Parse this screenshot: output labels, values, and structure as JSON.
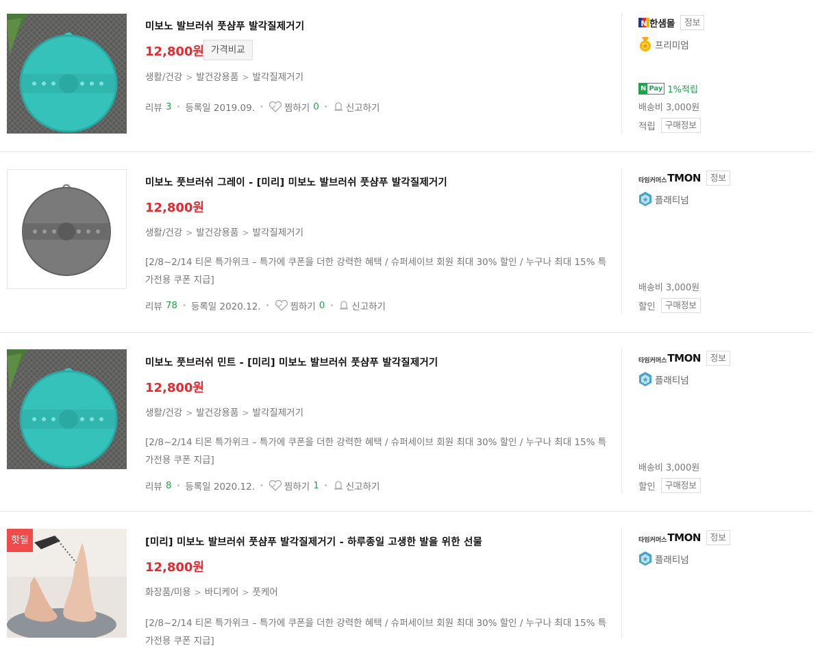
{
  "items": [
    {
      "title": "미보노 발브러쉬 풋샴푸 발각질제거기",
      "price": "12,800원",
      "compare_label": "가격비교",
      "category": [
        "생활/건강",
        "발건강용품",
        "발각질제거기"
      ],
      "description": "",
      "review_label": "리뷰",
      "review_count": "3",
      "reg_date": "등록일 2019.09.",
      "zzim_label": "찜하기",
      "zzim_count": "0",
      "report_label": "신고하기",
      "mall_name": "한샘몰",
      "mall_info_label": "정보",
      "grade": "프리미엄",
      "npay_label": "1%적립",
      "shipping": "배송비 3,000원",
      "benefit_label": "적립",
      "buy_info_label": "구매정보",
      "hot_badge": ""
    },
    {
      "title": "미보노 풋브러쉬 그레이 - [미리] 미보노 발브러쉬 풋샴푸 발각질제거기",
      "price": "12,800원",
      "compare_label": "",
      "category": [
        "생활/건강",
        "발건강용품",
        "발각질제거기"
      ],
      "description": "[2/8~2/14 티몬 특가위크 – 특가에 쿠폰을 더한 강력한 혜택 / 슈퍼세이브 회원 최대 30% 할인 / 누구나 최대 15% 특가전용 쿠폰 지급]",
      "review_label": "리뷰",
      "review_count": "78",
      "reg_date": "등록일 2020.12.",
      "zzim_label": "찜하기",
      "zzim_count": "0",
      "report_label": "신고하기",
      "mall_small": "타임커머스",
      "mall_name": "TMON",
      "mall_info_label": "정보",
      "grade": "플래티넘",
      "npay_label": "",
      "shipping": "배송비 3,000원",
      "benefit_label": "할인",
      "buy_info_label": "구매정보",
      "hot_badge": ""
    },
    {
      "title": "미보노 풋브러쉬 민트 - [미리] 미보노 발브러쉬 풋샴푸 발각질제거기",
      "price": "12,800원",
      "compare_label": "",
      "category": [
        "생활/건강",
        "발건강용품",
        "발각질제거기"
      ],
      "description": "[2/8~2/14 티몬 특가위크 – 특가에 쿠폰을 더한 강력한 혜택 / 슈퍼세이브 회원 최대 30% 할인 / 누구나 최대 15% 특가전용 쿠폰 지급]",
      "review_label": "리뷰",
      "review_count": "8",
      "reg_date": "등록일 2020.12.",
      "zzim_label": "찜하기",
      "zzim_count": "1",
      "report_label": "신고하기",
      "mall_small": "타임커머스",
      "mall_name": "TMON",
      "mall_info_label": "정보",
      "grade": "플래티넘",
      "npay_label": "",
      "shipping": "배송비 3,000원",
      "benefit_label": "할인",
      "buy_info_label": "구매정보",
      "hot_badge": ""
    },
    {
      "title": "[미리] 미보노 발브러쉬 풋샴푸 발각질제거기 - 하루종일 고생한 발을 위한 선물",
      "price": "12,800원",
      "compare_label": "",
      "category": [
        "화장품/미용",
        "바디케어",
        "풋케어"
      ],
      "description": "[2/8~2/14 티몬 특가위크 – 특가에 쿠폰을 더한 강력한 혜택 / 슈퍼세이브 회원 최대 30% 할인 / 누구나 최대 15% 특가전용 쿠폰 지급]",
      "mall_small": "타임커머스",
      "mall_name": "TMON",
      "mall_info_label": "정보",
      "grade": "플래티넘",
      "hot_badge": "핫딜"
    }
  ],
  "colors": {
    "price": "#e8282f",
    "count": "#1fa34a",
    "hot": "#f04b4b"
  }
}
